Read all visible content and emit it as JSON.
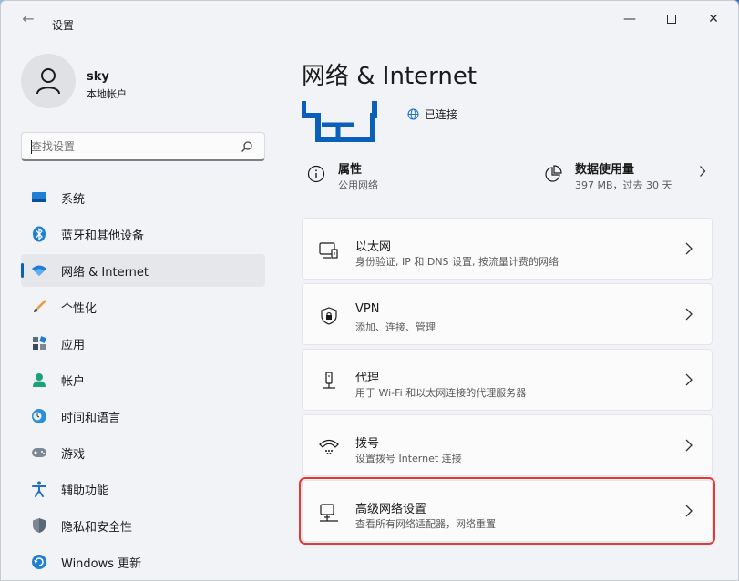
{
  "window": {
    "title": "设置"
  },
  "user": {
    "name": "sky",
    "type": "本地帐户"
  },
  "search": {
    "placeholder": "查找设置",
    "icon": "search-icon"
  },
  "sidebar": {
    "items": [
      {
        "label": "系统",
        "icon": "monitor-icon",
        "active": false
      },
      {
        "label": "蓝牙和其他设备",
        "icon": "bluetooth-icon",
        "active": false
      },
      {
        "label": "网络 & Internet",
        "icon": "wifi-icon",
        "active": true
      },
      {
        "label": "个性化",
        "icon": "brush-icon",
        "active": false
      },
      {
        "label": "应用",
        "icon": "apps-icon",
        "active": false
      },
      {
        "label": "帐户",
        "icon": "person-icon",
        "active": false
      },
      {
        "label": "时间和语言",
        "icon": "clock-globe-icon",
        "active": false
      },
      {
        "label": "游戏",
        "icon": "gamepad-icon",
        "active": false
      },
      {
        "label": "辅助功能",
        "icon": "accessibility-icon",
        "active": false
      },
      {
        "label": "隐私和安全性",
        "icon": "shield-icon",
        "active": false
      },
      {
        "label": "Windows 更新",
        "icon": "update-icon",
        "active": false
      }
    ]
  },
  "main": {
    "title": "网络 & Internet",
    "status": "已连接",
    "properties": {
      "title": "属性",
      "subtitle": "公用网络"
    },
    "data_usage": {
      "title": "数据使用量",
      "subtitle": "397 MB，过去 30 天"
    },
    "cards": [
      {
        "title": "以太网",
        "subtitle": "身份验证, IP 和 DNS 设置, 按流量计费的网络",
        "icon": "ethernet-icon"
      },
      {
        "title": "VPN",
        "subtitle": "添加、连接、管理",
        "icon": "vpn-shield-icon"
      },
      {
        "title": "代理",
        "subtitle": "用于 Wi-Fi 和以太网连接的代理服务器",
        "icon": "proxy-icon"
      },
      {
        "title": "拨号",
        "subtitle": "设置拨号 Internet 连接",
        "icon": "dialup-icon"
      },
      {
        "title": "高级网络设置",
        "subtitle": "查看所有网络适配器，网络重置",
        "icon": "advanced-network-icon",
        "highlighted": true
      }
    ]
  },
  "colors": {
    "accent": "#0a5fb8",
    "highlight": "#e53935"
  }
}
